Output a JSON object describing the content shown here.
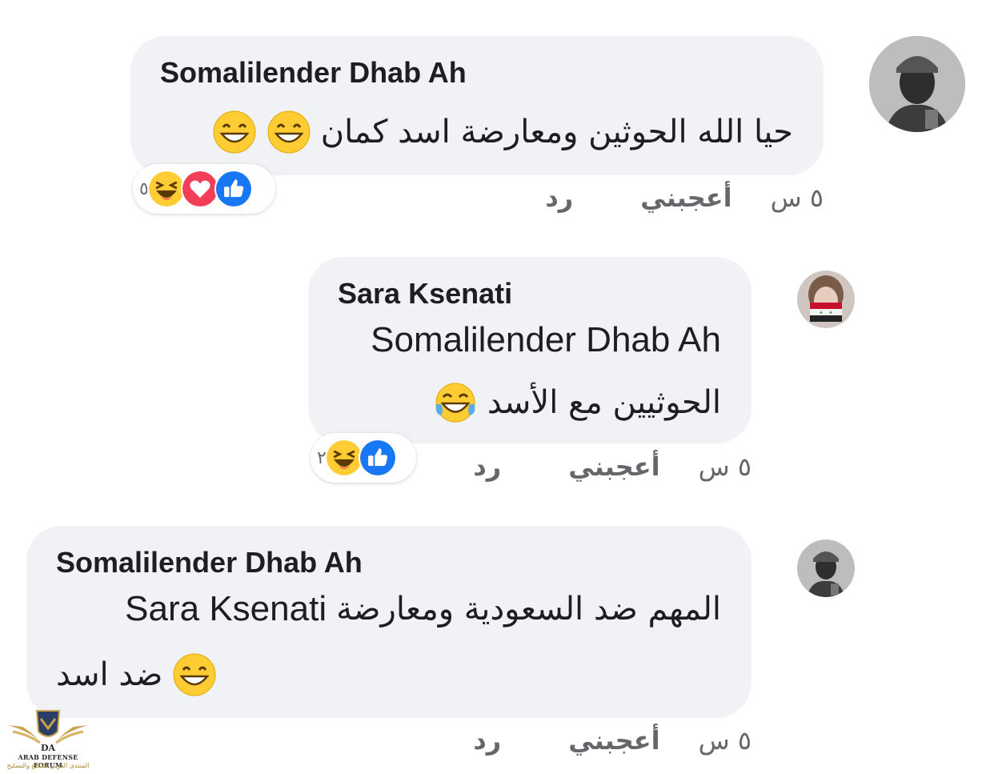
{
  "colors": {
    "bubble_bg": "#f0f2f5",
    "meta_text": "#65676b",
    "like_blue": "#1877f2",
    "love_red": "#f33e58",
    "emoji_yellow": "#ffcc33"
  },
  "comments": [
    {
      "author": "Somalilender Dhab Ah",
      "avatar_icon": "soldier-photo-avatar",
      "lines": [
        {
          "text": "حيا الله الحوثين ومعارضة اسد كمان",
          "trailing_emoji": "grinning-face-emoji"
        }
      ],
      "reactions": {
        "count": "٥",
        "icons": [
          "like-reaction-icon",
          "love-reaction-icon",
          "haha-reaction-icon"
        ]
      },
      "time": "٥ س",
      "like_label": "أعجبني",
      "reply_label": "رد"
    },
    {
      "author": "Sara Ksenati",
      "avatar_icon": "woman-flag-avatar",
      "lines": [
        {
          "text": "Somalilender Dhab Ah"
        },
        {
          "text": "الحوثيين مع الأسد",
          "trailing_emoji": "tears-of-joy-emoji"
        }
      ],
      "reactions": {
        "count": "٢",
        "icons": [
          "like-reaction-icon",
          "haha-reaction-icon"
        ]
      },
      "time": "٥ س",
      "like_label": "أعجبني",
      "reply_label": "رد"
    },
    {
      "author": "Somalilender Dhab Ah",
      "avatar_icon": "soldier-photo-avatar",
      "lines": [
        {
          "text_ar": "المهم ضد السعودية ومعارضة",
          "text_en": "Sara Ksenati"
        },
        {
          "text": "ضد اسد",
          "trailing_emoji": "grinning-face-emoji"
        }
      ],
      "time": "٥ س",
      "like_label": "أعجبني",
      "reply_label": "رد"
    }
  ],
  "watermark": {
    "logo_letters": "DA",
    "line1": "ARAB DEFENSE FORUM",
    "line2": "المنتدى العربي للدفاع والتسليح"
  }
}
